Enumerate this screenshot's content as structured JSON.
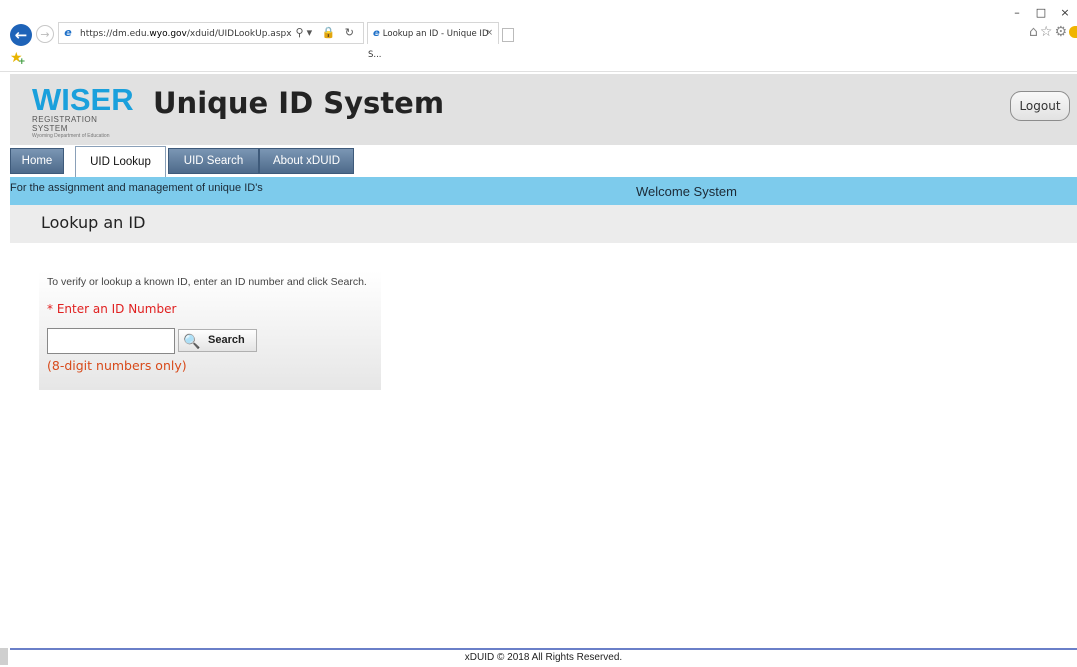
{
  "browser": {
    "url_prefix": "https://dm.edu.",
    "url_host": "wyo.gov",
    "url_path": "/xduid/UIDLookUp.aspx",
    "tab_title": "Lookup an ID - Unique ID S...",
    "address_tools": "⌕ ▾ 🔒 ↻"
  },
  "header": {
    "logo_main": "WISER",
    "logo_sub": "REGISTRATION SYSTEM",
    "logo_sub2": "Wyoming Department of Education",
    "title": "Unique ID System",
    "logout_label": "Logout"
  },
  "nav": {
    "items": [
      {
        "label": "Home"
      },
      {
        "label": "UID Lookup",
        "active": true
      },
      {
        "label": "UID Search"
      },
      {
        "label": "About xDUID"
      }
    ]
  },
  "banner": {
    "tagline": "For the assignment and management of unique ID's",
    "welcome": "Welcome System"
  },
  "page": {
    "title": "Lookup an ID"
  },
  "lookup": {
    "instructions": "To verify or lookup a known ID, enter an ID number and click Search.",
    "required_label": "* Enter an ID Number",
    "input_value": "",
    "search_label": "Search",
    "hint": "(8-digit numbers only)"
  },
  "footer": {
    "text": "xDUID   © 2018 All Rights Reserved."
  },
  "colors": {
    "banner": "#7dcbec",
    "nav_tab": "#5a7696",
    "logo": "#1aa0dc",
    "required": "#e02020",
    "hint": "#d84a1a"
  }
}
